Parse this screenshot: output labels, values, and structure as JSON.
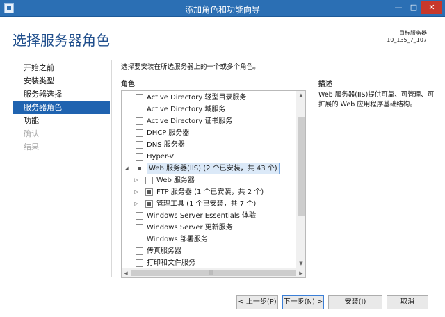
{
  "window": {
    "title": "添加角色和功能向导",
    "minimize": "—",
    "maximize": "□",
    "close": "✕"
  },
  "header": {
    "title": "选择服务器角色",
    "target_label": "目标服务器",
    "target_value": "10_135_7_107"
  },
  "nav": {
    "items": [
      {
        "label": "开始之前",
        "state": "normal"
      },
      {
        "label": "安装类型",
        "state": "normal"
      },
      {
        "label": "服务器选择",
        "state": "normal"
      },
      {
        "label": "服务器角色",
        "state": "active"
      },
      {
        "label": "功能",
        "state": "normal"
      },
      {
        "label": "确认",
        "state": "disabled"
      },
      {
        "label": "结果",
        "state": "disabled"
      }
    ]
  },
  "content": {
    "instruction": "选择要安装在所选服务器上的一个或多个角色。",
    "roles_header": "角色",
    "description_header": "描述",
    "description_text": "Web 服务器(IIS)提供可靠、可管理、可扩展的 Web 应用程序基础结构。",
    "roles": [
      {
        "label": "Active Directory 轻型目录服务",
        "level": 0,
        "expander": "",
        "check": "none"
      },
      {
        "label": "Active Directory 域服务",
        "level": 0,
        "expander": "",
        "check": "none"
      },
      {
        "label": "Active Directory 证书服务",
        "level": 0,
        "expander": "",
        "check": "none"
      },
      {
        "label": "DHCP 服务器",
        "level": 0,
        "expander": "",
        "check": "none"
      },
      {
        "label": "DNS 服务器",
        "level": 0,
        "expander": "",
        "check": "none"
      },
      {
        "label": "Hyper-V",
        "level": 0,
        "expander": "",
        "check": "none"
      },
      {
        "label": "Web 服务器(IIS) (2 个已安装，共 43 个)",
        "level": 0,
        "expander": "◢",
        "check": "partial",
        "selected": true
      },
      {
        "label": "Web 服务器",
        "level": 1,
        "expander": "▷",
        "check": "none"
      },
      {
        "label": "FTP 服务器 (1 个已安装，共 2 个)",
        "level": 1,
        "expander": "▷",
        "check": "partial"
      },
      {
        "label": "管理工具 (1 个已安装，共 7 个)",
        "level": 1,
        "expander": "▷",
        "check": "partial"
      },
      {
        "label": "Windows Server Essentials 体验",
        "level": 0,
        "expander": "",
        "check": "none"
      },
      {
        "label": "Windows Server 更新服务",
        "level": 0,
        "expander": "",
        "check": "none"
      },
      {
        "label": "Windows 部署服务",
        "level": 0,
        "expander": "",
        "check": "none"
      },
      {
        "label": "传真服务器",
        "level": 0,
        "expander": "",
        "check": "none"
      },
      {
        "label": "打印和文件服务",
        "level": 0,
        "expander": "",
        "check": "none"
      }
    ],
    "hover_marker": "≡",
    "scroll_up": "▲",
    "scroll_down": "▼",
    "scroll_left": "◀",
    "scroll_right": "▶",
    "scroll_grip": "|||"
  },
  "footer": {
    "prev_label": "< 上一步(P)",
    "next_label": "下一步(N) >",
    "install_label": "安装(I)",
    "cancel_label": "取消"
  }
}
